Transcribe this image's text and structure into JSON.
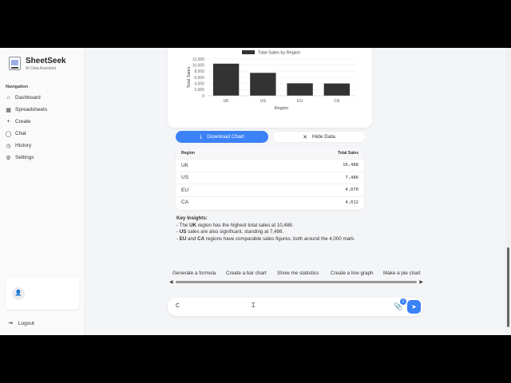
{
  "app": {
    "name": "SheetSeek",
    "subtitle": "AI Data Assistant"
  },
  "sidebar": {
    "heading": "Navigation",
    "items": [
      {
        "label": "Dashboard",
        "icon": "home-icon"
      },
      {
        "label": "Spreadsheets",
        "icon": "grid-icon"
      },
      {
        "label": "Create",
        "icon": "plus-icon"
      },
      {
        "label": "Chat",
        "icon": "chat-icon"
      },
      {
        "label": "History",
        "icon": "clock-icon"
      },
      {
        "label": "Settings",
        "icon": "gear-icon"
      }
    ],
    "logout_label": "Logout"
  },
  "chart_data": {
    "type": "bar",
    "categories": [
      "UK",
      "US",
      "EU",
      "CA"
    ],
    "series": [
      {
        "name": "Total Sales by Region",
        "values": [
          10488,
          7486,
          4070,
          4012
        ]
      }
    ],
    "title": "",
    "xlabel": "Region",
    "ylabel": "Total Sales",
    "ylim": [
      0,
      12000
    ],
    "yticks": [
      "0",
      "2,000",
      "4,000",
      "6,000",
      "8,000",
      "10,000",
      "12,000"
    ],
    "legend_position": "top-center",
    "color": "#333333"
  },
  "buttons": {
    "download": "Download Chart",
    "hide": "Hide Data"
  },
  "table": {
    "headers": [
      "Region",
      "Total Sales"
    ],
    "rows": [
      [
        "UK",
        "10,488"
      ],
      [
        "US",
        "7,486"
      ],
      [
        "EU",
        "4,070"
      ],
      [
        "CA",
        "4,012"
      ]
    ]
  },
  "insights": {
    "title": "Key Insights:",
    "lines": [
      {
        "pre": "- The ",
        "bold": "UK",
        "post": " region has the highest total sales at 10,488."
      },
      {
        "pre": "- ",
        "bold": "US",
        "post": " sales are also significant, standing at 7,486."
      },
      {
        "pre": "- ",
        "bold": "EU",
        "mid": " and ",
        "bold2": "CA",
        "post": " regions have comparable sales figures, both around the 4,000 mark."
      }
    ]
  },
  "suggestions": [
    "Generate a formula",
    "Create a bar chart",
    "Show me statistics",
    "Create a line graph",
    "Make a pie chart"
  ],
  "input": {
    "value": "C",
    "badge": "1"
  }
}
